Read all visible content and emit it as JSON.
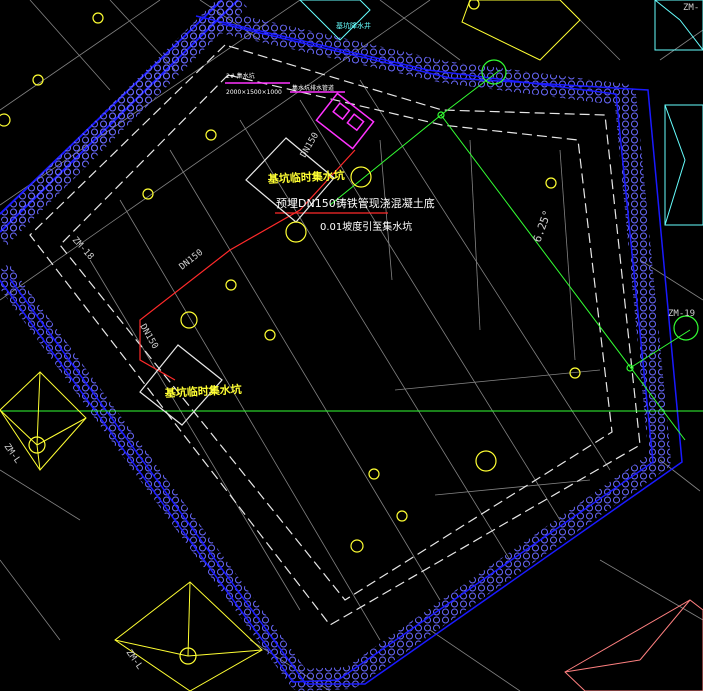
{
  "drawing": {
    "colors": {
      "background": "#000000",
      "wall_blue": "#1a1aff",
      "wall_hatch": "#6a6aff",
      "footprint_dash": "#e8e8e8",
      "grid_lines": "#bdbdbd",
      "pipe_red": "#ff2a2a",
      "pipe_magenta": "#ff33ff",
      "axis_green": "#33ff33",
      "pile_yellow": "#ffff33",
      "cap_cyan": "#66ffff",
      "cap_salmon": "#ff8080"
    },
    "labels": {
      "pit_a": "基坑临时集水坑",
      "pit_b": "基坑临时集水坑",
      "pipe_note": "预埋DN150铸铁管现浇混凝土底",
      "pump_note": "0.01坡度引至集水坑",
      "pipe_dn1": "DN150",
      "pipe_dn2": "DN150",
      "pipe_dn3": "DN150",
      "slope": "6.25°",
      "cap_zm18": "ZM-18",
      "cap_zm19": "ZM-19",
      "cap_zm_left": "ZM-L",
      "cap_zm_bottom": "ZM-L",
      "cap_zm_topright": "ZM-",
      "top_note1": "2# 集水坑",
      "top_note2": "2000×1500×1000",
      "top_note3": "集水坑排水管道",
      "top_cyan": "基坑降水井"
    },
    "icons": [
      "collection-well-icon",
      "drain-pit-icon"
    ]
  }
}
